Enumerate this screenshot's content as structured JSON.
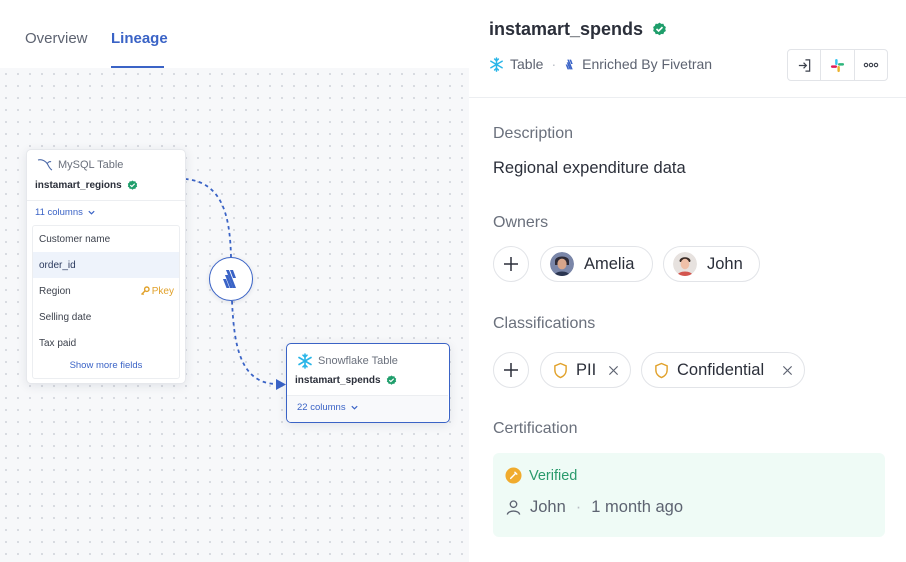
{
  "tabs": {
    "overview": "Overview",
    "lineage": "Lineage"
  },
  "lineage": {
    "source": {
      "type": "MySQL Table",
      "name": "instamart_regions",
      "columns": "11 columns",
      "fields": [
        {
          "name": "Customer name",
          "tag": ""
        },
        {
          "name": "order_id",
          "tag": ""
        },
        {
          "name": "Region",
          "tag": "Pkey"
        },
        {
          "name": "Selling date",
          "tag": ""
        },
        {
          "name": "Tax paid",
          "tag": ""
        }
      ],
      "show_more": "Show more fields"
    },
    "target": {
      "type": "Snowflake Table",
      "name": "instamart_spends",
      "columns": "22 columns"
    },
    "process_icon": "fivetran-icon"
  },
  "asset": {
    "title": "instamart_spends",
    "type": "Table",
    "enriched": "Enriched By Fivetran",
    "actions": [
      "open-icon",
      "slack-icon",
      "more-icon"
    ]
  },
  "description": {
    "label": "Description",
    "text": "Regional expenditure data"
  },
  "owners": {
    "label": "Owners",
    "items": [
      "Amelia",
      "John"
    ]
  },
  "classifications": {
    "label": "Classifications",
    "items": [
      "PII",
      "Confidential"
    ]
  },
  "certification": {
    "label": "Certification",
    "status": "Verified",
    "user": "John",
    "time": "1 month ago"
  },
  "colors": {
    "accent": "#3a63c6",
    "verified": "#1f9e6b",
    "pkey": "#e1a12a",
    "cert_bg": "#effbf6"
  }
}
